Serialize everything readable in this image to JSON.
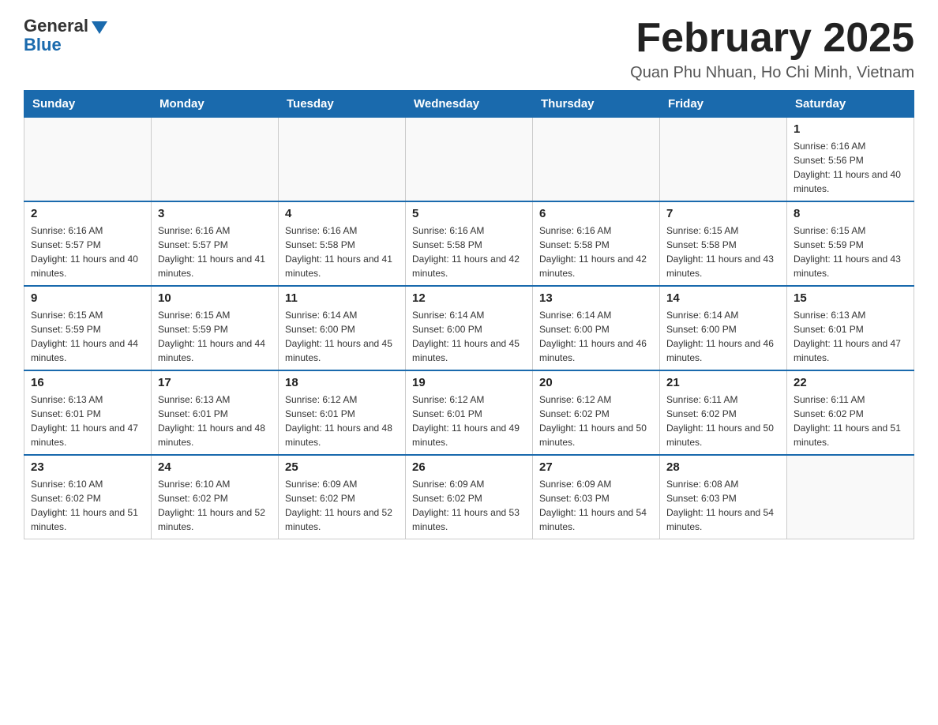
{
  "header": {
    "logo_general": "General",
    "logo_blue": "Blue",
    "month_title": "February 2025",
    "location": "Quan Phu Nhuan, Ho Chi Minh, Vietnam"
  },
  "days_of_week": [
    "Sunday",
    "Monday",
    "Tuesday",
    "Wednesday",
    "Thursday",
    "Friday",
    "Saturday"
  ],
  "weeks": [
    {
      "days": [
        {
          "number": "",
          "sunrise": "",
          "sunset": "",
          "daylight": ""
        },
        {
          "number": "",
          "sunrise": "",
          "sunset": "",
          "daylight": ""
        },
        {
          "number": "",
          "sunrise": "",
          "sunset": "",
          "daylight": ""
        },
        {
          "number": "",
          "sunrise": "",
          "sunset": "",
          "daylight": ""
        },
        {
          "number": "",
          "sunrise": "",
          "sunset": "",
          "daylight": ""
        },
        {
          "number": "",
          "sunrise": "",
          "sunset": "",
          "daylight": ""
        },
        {
          "number": "1",
          "sunrise": "Sunrise: 6:16 AM",
          "sunset": "Sunset: 5:56 PM",
          "daylight": "Daylight: 11 hours and 40 minutes."
        }
      ]
    },
    {
      "days": [
        {
          "number": "2",
          "sunrise": "Sunrise: 6:16 AM",
          "sunset": "Sunset: 5:57 PM",
          "daylight": "Daylight: 11 hours and 40 minutes."
        },
        {
          "number": "3",
          "sunrise": "Sunrise: 6:16 AM",
          "sunset": "Sunset: 5:57 PM",
          "daylight": "Daylight: 11 hours and 41 minutes."
        },
        {
          "number": "4",
          "sunrise": "Sunrise: 6:16 AM",
          "sunset": "Sunset: 5:58 PM",
          "daylight": "Daylight: 11 hours and 41 minutes."
        },
        {
          "number": "5",
          "sunrise": "Sunrise: 6:16 AM",
          "sunset": "Sunset: 5:58 PM",
          "daylight": "Daylight: 11 hours and 42 minutes."
        },
        {
          "number": "6",
          "sunrise": "Sunrise: 6:16 AM",
          "sunset": "Sunset: 5:58 PM",
          "daylight": "Daylight: 11 hours and 42 minutes."
        },
        {
          "number": "7",
          "sunrise": "Sunrise: 6:15 AM",
          "sunset": "Sunset: 5:58 PM",
          "daylight": "Daylight: 11 hours and 43 minutes."
        },
        {
          "number": "8",
          "sunrise": "Sunrise: 6:15 AM",
          "sunset": "Sunset: 5:59 PM",
          "daylight": "Daylight: 11 hours and 43 minutes."
        }
      ]
    },
    {
      "days": [
        {
          "number": "9",
          "sunrise": "Sunrise: 6:15 AM",
          "sunset": "Sunset: 5:59 PM",
          "daylight": "Daylight: 11 hours and 44 minutes."
        },
        {
          "number": "10",
          "sunrise": "Sunrise: 6:15 AM",
          "sunset": "Sunset: 5:59 PM",
          "daylight": "Daylight: 11 hours and 44 minutes."
        },
        {
          "number": "11",
          "sunrise": "Sunrise: 6:14 AM",
          "sunset": "Sunset: 6:00 PM",
          "daylight": "Daylight: 11 hours and 45 minutes."
        },
        {
          "number": "12",
          "sunrise": "Sunrise: 6:14 AM",
          "sunset": "Sunset: 6:00 PM",
          "daylight": "Daylight: 11 hours and 45 minutes."
        },
        {
          "number": "13",
          "sunrise": "Sunrise: 6:14 AM",
          "sunset": "Sunset: 6:00 PM",
          "daylight": "Daylight: 11 hours and 46 minutes."
        },
        {
          "number": "14",
          "sunrise": "Sunrise: 6:14 AM",
          "sunset": "Sunset: 6:00 PM",
          "daylight": "Daylight: 11 hours and 46 minutes."
        },
        {
          "number": "15",
          "sunrise": "Sunrise: 6:13 AM",
          "sunset": "Sunset: 6:01 PM",
          "daylight": "Daylight: 11 hours and 47 minutes."
        }
      ]
    },
    {
      "days": [
        {
          "number": "16",
          "sunrise": "Sunrise: 6:13 AM",
          "sunset": "Sunset: 6:01 PM",
          "daylight": "Daylight: 11 hours and 47 minutes."
        },
        {
          "number": "17",
          "sunrise": "Sunrise: 6:13 AM",
          "sunset": "Sunset: 6:01 PM",
          "daylight": "Daylight: 11 hours and 48 minutes."
        },
        {
          "number": "18",
          "sunrise": "Sunrise: 6:12 AM",
          "sunset": "Sunset: 6:01 PM",
          "daylight": "Daylight: 11 hours and 48 minutes."
        },
        {
          "number": "19",
          "sunrise": "Sunrise: 6:12 AM",
          "sunset": "Sunset: 6:01 PM",
          "daylight": "Daylight: 11 hours and 49 minutes."
        },
        {
          "number": "20",
          "sunrise": "Sunrise: 6:12 AM",
          "sunset": "Sunset: 6:02 PM",
          "daylight": "Daylight: 11 hours and 50 minutes."
        },
        {
          "number": "21",
          "sunrise": "Sunrise: 6:11 AM",
          "sunset": "Sunset: 6:02 PM",
          "daylight": "Daylight: 11 hours and 50 minutes."
        },
        {
          "number": "22",
          "sunrise": "Sunrise: 6:11 AM",
          "sunset": "Sunset: 6:02 PM",
          "daylight": "Daylight: 11 hours and 51 minutes."
        }
      ]
    },
    {
      "days": [
        {
          "number": "23",
          "sunrise": "Sunrise: 6:10 AM",
          "sunset": "Sunset: 6:02 PM",
          "daylight": "Daylight: 11 hours and 51 minutes."
        },
        {
          "number": "24",
          "sunrise": "Sunrise: 6:10 AM",
          "sunset": "Sunset: 6:02 PM",
          "daylight": "Daylight: 11 hours and 52 minutes."
        },
        {
          "number": "25",
          "sunrise": "Sunrise: 6:09 AM",
          "sunset": "Sunset: 6:02 PM",
          "daylight": "Daylight: 11 hours and 52 minutes."
        },
        {
          "number": "26",
          "sunrise": "Sunrise: 6:09 AM",
          "sunset": "Sunset: 6:02 PM",
          "daylight": "Daylight: 11 hours and 53 minutes."
        },
        {
          "number": "27",
          "sunrise": "Sunrise: 6:09 AM",
          "sunset": "Sunset: 6:03 PM",
          "daylight": "Daylight: 11 hours and 54 minutes."
        },
        {
          "number": "28",
          "sunrise": "Sunrise: 6:08 AM",
          "sunset": "Sunset: 6:03 PM",
          "daylight": "Daylight: 11 hours and 54 minutes."
        },
        {
          "number": "",
          "sunrise": "",
          "sunset": "",
          "daylight": ""
        }
      ]
    }
  ]
}
